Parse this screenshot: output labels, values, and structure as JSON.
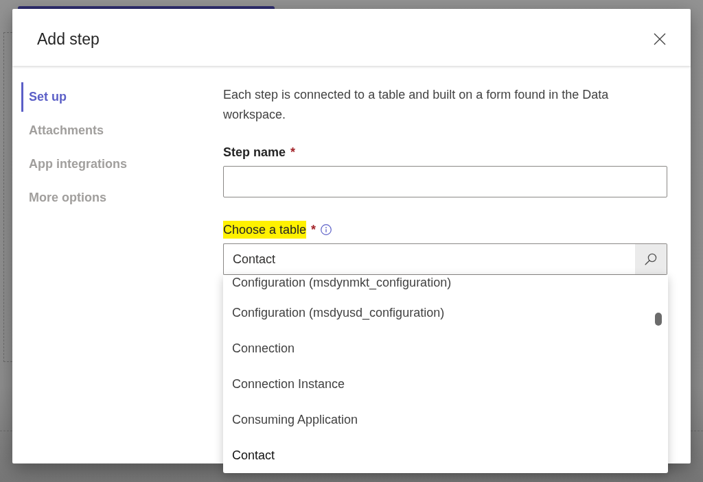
{
  "dialog": {
    "title": "Add step"
  },
  "sidebar": {
    "items": [
      {
        "label": "Set up",
        "selected": true
      },
      {
        "label": "Attachments",
        "selected": false
      },
      {
        "label": "App integrations",
        "selected": false
      },
      {
        "label": "More options",
        "selected": false
      }
    ]
  },
  "description": "Each step is connected to a table and built on a form found in the Data workspace.",
  "fields": [
    {
      "kind": "text",
      "label": "Step name",
      "required_mark": "*",
      "highlighted": false,
      "has_info": false
    },
    {
      "kind": "lookup",
      "label": "Choose a table",
      "required_mark": "*",
      "highlighted": true,
      "has_info": true,
      "value": "Contact",
      "options": [
        {
          "label": "Configuration (msdynmkt_configuration)",
          "selected": false
        },
        {
          "label": "Configuration (msdyusd_configuration)",
          "selected": false
        },
        {
          "label": "Connection",
          "selected": false
        },
        {
          "label": "Connection Instance",
          "selected": false
        },
        {
          "label": "Consuming Application",
          "selected": false
        },
        {
          "label": "Contact",
          "selected": true
        }
      ]
    }
  ]
}
